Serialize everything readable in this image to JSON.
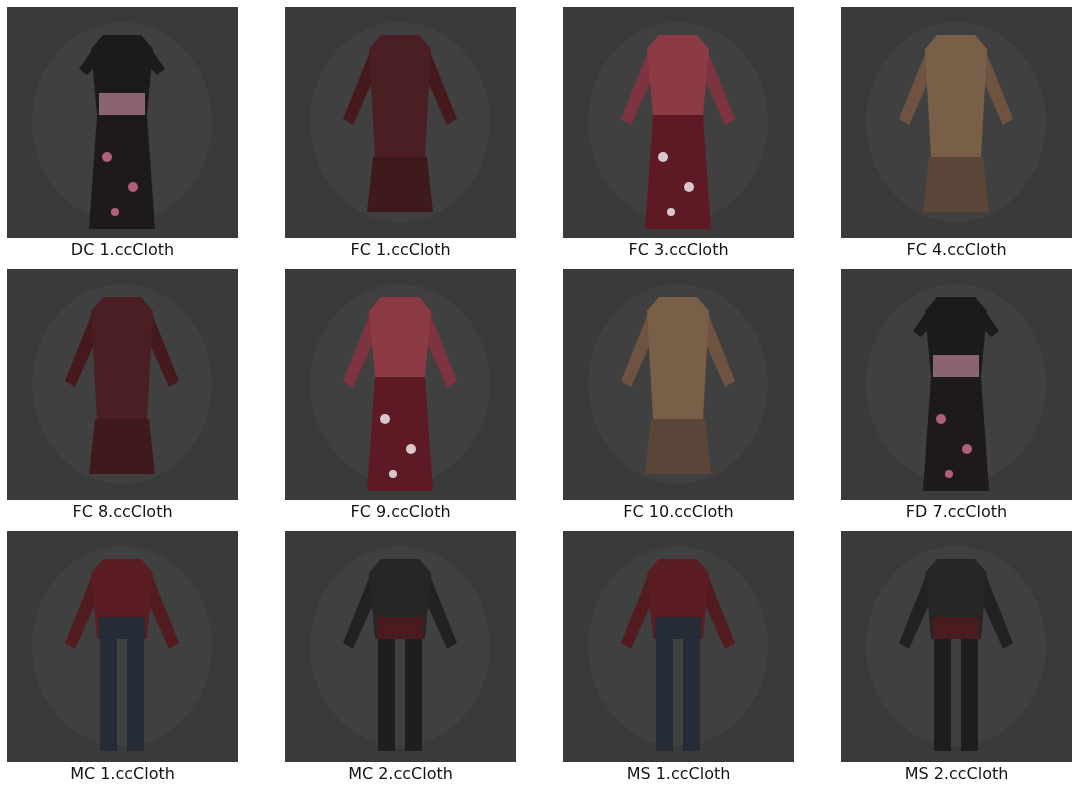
{
  "files": [
    {
      "name": "DC 1.ccCloth"
    },
    {
      "name": "FC 1.ccCloth"
    },
    {
      "name": "FC 3.ccCloth"
    },
    {
      "name": "FC 4.ccCloth"
    },
    {
      "name": "FC 8.ccCloth"
    },
    {
      "name": "FC 9.ccCloth"
    },
    {
      "name": "FC 10.ccCloth"
    },
    {
      "name": "FD 7.ccCloth"
    },
    {
      "name": "MC 1.ccCloth"
    },
    {
      "name": "MC 2.ccCloth"
    },
    {
      "name": "MS 1.ccCloth"
    },
    {
      "name": "MS 2.ccCloth"
    }
  ]
}
